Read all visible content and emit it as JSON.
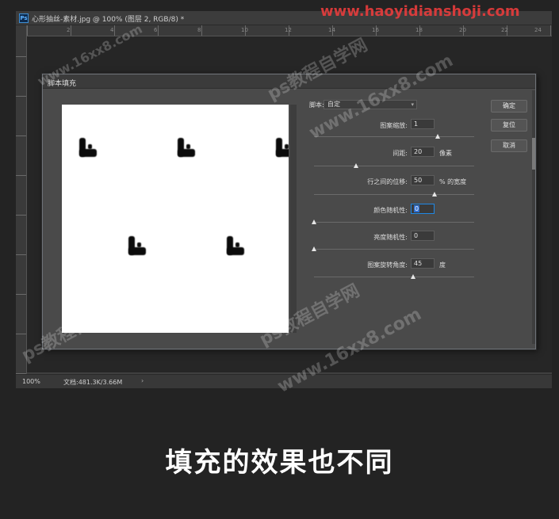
{
  "photoshop": {
    "doc_title": "心形抽丝-素材.jpg @ 100% (图层 2, RGB/8) *",
    "ruler_numbers_top": [
      "2",
      "4",
      "6",
      "8",
      "10",
      "12",
      "14",
      "16",
      "18",
      "20",
      "22",
      "24"
    ],
    "status": {
      "zoom": "100%",
      "doc_info": "文档:481.3K/3.66M",
      "arrow": "›"
    }
  },
  "dialog": {
    "title": "脚本填充",
    "script_label": "脚本:",
    "script_value": "自定",
    "params": [
      {
        "label": "图案缩放:",
        "value": "1",
        "unit": "",
        "slider_fraction": 0.77
      },
      {
        "label": "间距:",
        "value": "20",
        "unit": "像素",
        "slider_fraction": 0.26
      },
      {
        "label": "行之间的位移:",
        "value": "50",
        "unit": "% 的宽度",
        "slider_fraction": 0.75
      },
      {
        "label": "颜色随机性:",
        "value": "0",
        "unit": "",
        "slider_fraction": 0.0,
        "active": true
      },
      {
        "label": "亮度随机性:",
        "value": "0",
        "unit": "",
        "slider_fraction": 0.0
      },
      {
        "label": "图案旋转角度:",
        "value": "45",
        "unit": "度",
        "slider_fraction": 0.62
      }
    ],
    "buttons": {
      "ok": "确定",
      "reset": "复位",
      "cancel": "取消"
    }
  },
  "caption": "填充的效果也不同",
  "watermarks": {
    "site_cn": "ps教程自学网",
    "site_url": "www.16xx8.com",
    "top_url": "www.haoyidianshoji.com"
  },
  "colors": {
    "panel": "#4a4a4a",
    "dark_bg": "#232323",
    "accent": "#1f88e5"
  }
}
